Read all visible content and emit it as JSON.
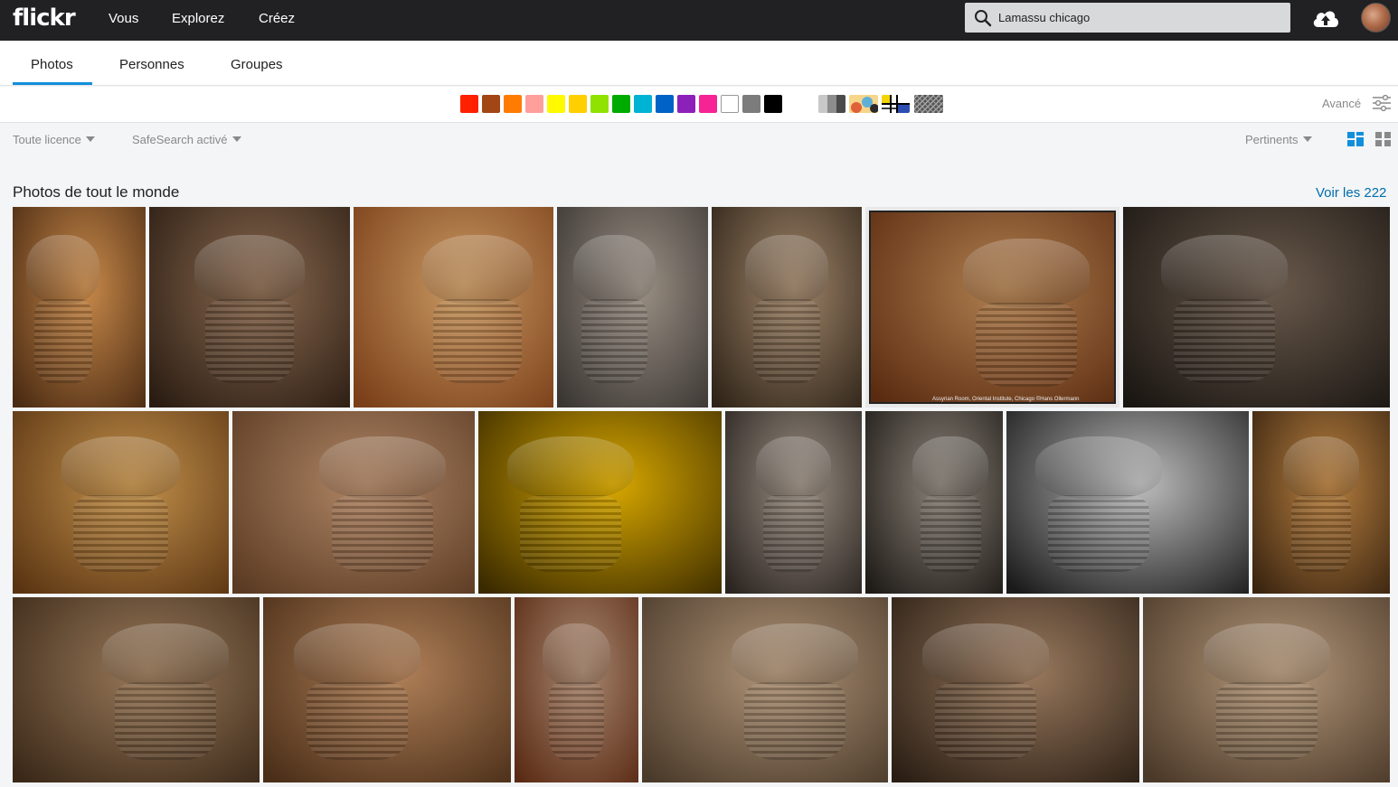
{
  "topbar": {
    "logo": "flickr",
    "nav": [
      "Vous",
      "Explorez",
      "Créez"
    ],
    "search_value": "Lamassu chicago",
    "upload_icon": "cloud-upload-icon",
    "avatar_icon": "avatar"
  },
  "tabs": [
    "Photos",
    "Personnes",
    "Groupes"
  ],
  "active_tab": "Photos",
  "color_filters": [
    "#ff2000",
    "#a24615",
    "#ff7c00",
    "#ff9f9c",
    "#fffa00",
    "#ffcf00",
    "#90e200",
    "#00ab00",
    "#00b2d4",
    "#0062c6",
    "#8c20ba",
    "#f52394",
    "#ffffff",
    "#7c7c7c",
    "#000000"
  ],
  "style_filters": [
    "black-and-white",
    "shallow-depth-of-field",
    "minimalist",
    "patterns"
  ],
  "advanced_label": "Avancé",
  "filters": {
    "license": "Toute licence",
    "safesearch": "SafeSearch activé",
    "sort": "Pertinents"
  },
  "section": {
    "title": "Photos de tout le monde",
    "see_all": "Voir les 222"
  },
  "photo_overlay_text": "Assyrian Room, Oriental Institute, Chicago     ©Hans Ollermann",
  "colors": {
    "topbar": "#212124",
    "accent": "#128fdc",
    "link": "#006dac"
  }
}
